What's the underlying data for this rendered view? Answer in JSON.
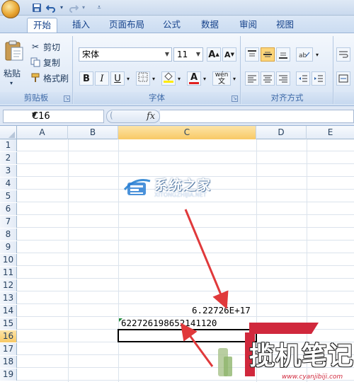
{
  "quick_access": {
    "save_icon": "save-icon",
    "undo_icon": "undo-icon",
    "redo_icon": "redo-icon"
  },
  "tabs": [
    {
      "label": "开始",
      "active": true
    },
    {
      "label": "插入",
      "active": false
    },
    {
      "label": "页面布局",
      "active": false
    },
    {
      "label": "公式",
      "active": false
    },
    {
      "label": "数据",
      "active": false
    },
    {
      "label": "审阅",
      "active": false
    },
    {
      "label": "视图",
      "active": false
    }
  ],
  "clipboard": {
    "group_label": "剪贴板",
    "paste_label": "粘贴",
    "cut_label": "剪切",
    "copy_label": "复制",
    "format_painter_label": "格式刷"
  },
  "font": {
    "group_label": "字体",
    "font_name": "宋体",
    "font_size": "11",
    "grow_label": "A",
    "shrink_label": "A",
    "bold_label": "B",
    "italic_label": "I",
    "underline_label": "U",
    "font_color_label": "A",
    "phonetic_label": "wén"
  },
  "alignment": {
    "group_label": "对齐方式"
  },
  "formula_bar": {
    "name_box": "C16",
    "fx_label": "fx",
    "formula": ""
  },
  "sheet": {
    "columns": [
      "A",
      "B",
      "C",
      "D",
      "E"
    ],
    "selected_column": "C",
    "rows": [
      "1",
      "2",
      "3",
      "4",
      "5",
      "6",
      "7",
      "8",
      "9",
      "10",
      "11",
      "12",
      "13",
      "14",
      "15",
      "16",
      "17",
      "18",
      "19"
    ],
    "selected_row": "16",
    "cells": {
      "C14": "6.22726E+17",
      "C15": "622726198652141120"
    }
  },
  "watermark_top": {
    "title": "系统之家",
    "subtitle": "XITONGZHIJIA.NET"
  },
  "watermark_bottom": {
    "title": "揽机笔记",
    "url": "www.cyanjibiji.com"
  },
  "colors": {
    "ribbon": "#dfe9f5",
    "selected_header": "#f8c965",
    "annotation_arrow": "#e0393b"
  }
}
